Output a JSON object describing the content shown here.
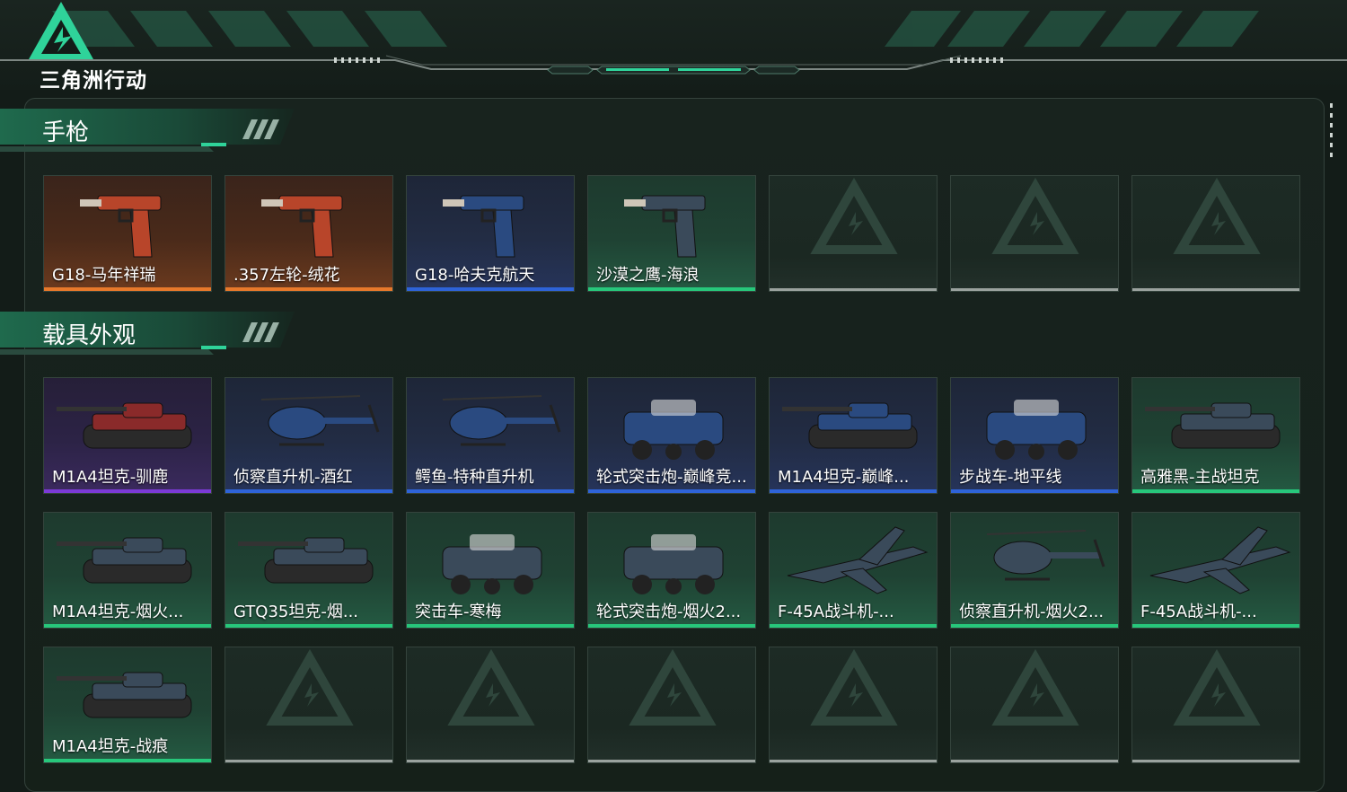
{
  "header": {
    "logo_text": "三角洲行动",
    "accent_color": "#2fd39a"
  },
  "sections": [
    {
      "title": "手枪",
      "rows": [
        [
          {
            "label": "G18-马年祥瑞",
            "rarity": "orange",
            "icon": "pistol-icon"
          },
          {
            "label": ".357左轮-绒花",
            "rarity": "orange",
            "icon": "revolver-icon"
          },
          {
            "label": "G18-哈夫克航天",
            "rarity": "blue",
            "icon": "pistol-icon"
          },
          {
            "label": "沙漠之鹰-海浪",
            "rarity": "green",
            "icon": "pistol-icon"
          },
          {
            "label": "",
            "rarity": "empty",
            "icon": "empty-slot-icon"
          },
          {
            "label": "",
            "rarity": "empty",
            "icon": "empty-slot-icon"
          },
          {
            "label": "",
            "rarity": "empty",
            "icon": "empty-slot-icon"
          }
        ]
      ]
    },
    {
      "title": "载具外观",
      "rows": [
        [
          {
            "label": "M1A4坦克-驯鹿",
            "rarity": "purple",
            "icon": "tank-icon"
          },
          {
            "label": "侦察直升机-酒红",
            "rarity": "blue",
            "icon": "helicopter-icon"
          },
          {
            "label": "鳄鱼-特种直升机",
            "rarity": "blue",
            "icon": "helicopter-icon"
          },
          {
            "label": "轮式突击炮-巅峰竞...",
            "rarity": "blue",
            "icon": "armored-car-icon"
          },
          {
            "label": "M1A4坦克-巅峰...",
            "rarity": "blue",
            "icon": "tank-icon"
          },
          {
            "label": "步战车-地平线",
            "rarity": "blue",
            "icon": "ifv-icon"
          },
          {
            "label": "高雅黑-主战坦克",
            "rarity": "green",
            "icon": "tank-icon"
          }
        ],
        [
          {
            "label": "M1A4坦克-烟火...",
            "rarity": "green",
            "icon": "tank-icon"
          },
          {
            "label": "GTQ35坦克-烟...",
            "rarity": "green",
            "icon": "tank-icon"
          },
          {
            "label": "突击车-寒梅",
            "rarity": "green",
            "icon": "armored-car-icon"
          },
          {
            "label": "轮式突击炮-烟火2...",
            "rarity": "green",
            "icon": "armored-car-icon"
          },
          {
            "label": "F-45A战斗机-...",
            "rarity": "green",
            "icon": "jet-icon"
          },
          {
            "label": "侦察直升机-烟火2...",
            "rarity": "green",
            "icon": "helicopter-icon"
          },
          {
            "label": "F-45A战斗机-...",
            "rarity": "green",
            "icon": "jet-icon"
          }
        ],
        [
          {
            "label": "M1A4坦克-战痕",
            "rarity": "green",
            "icon": "tank-icon"
          },
          {
            "label": "",
            "rarity": "empty",
            "icon": "empty-slot-icon"
          },
          {
            "label": "",
            "rarity": "empty",
            "icon": "empty-slot-icon"
          },
          {
            "label": "",
            "rarity": "empty",
            "icon": "empty-slot-icon"
          },
          {
            "label": "",
            "rarity": "empty",
            "icon": "empty-slot-icon"
          },
          {
            "label": "",
            "rarity": "empty",
            "icon": "empty-slot-icon"
          },
          {
            "label": "",
            "rarity": "empty",
            "icon": "empty-slot-icon"
          }
        ]
      ]
    }
  ],
  "rarity_colors": {
    "orange": "#e7792b",
    "blue": "#2e63d8",
    "purple": "#7b3ad6",
    "green": "#27c77b",
    "empty": "#9aa29e"
  }
}
